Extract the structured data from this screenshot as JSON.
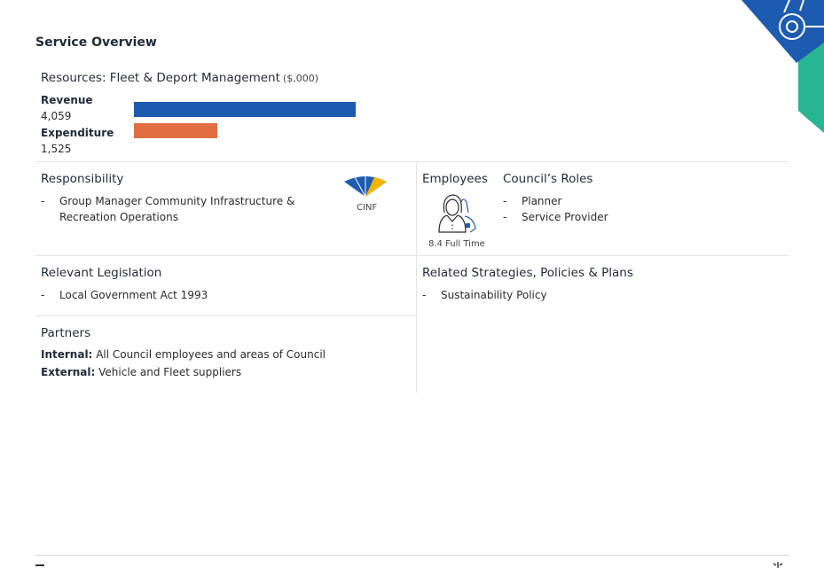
{
  "page_title": "Service Overview",
  "resources": {
    "title": "Resources: Fleet & Deport Management",
    "unit": "($,000)",
    "revenue_label": "Revenue",
    "revenue_value": "4,059",
    "expenditure_label": "Expenditure",
    "expenditure_value": "1,525"
  },
  "chart_data": {
    "type": "bar",
    "categories": [
      "Revenue",
      "Expenditure"
    ],
    "values": [
      4059,
      1525
    ],
    "colors": [
      "#1d5bb0",
      "#e16d40"
    ]
  },
  "responsibility": {
    "title": "Responsibility",
    "items": [
      "Group Manager Community Infrastructure & Recreation Operations"
    ],
    "directorate_label": "CINF"
  },
  "employees": {
    "title": "Employees",
    "count_label": "8.4 Full Time"
  },
  "roles": {
    "title": "Council’s Roles",
    "items": [
      "Planner",
      "Service Provider"
    ]
  },
  "legislation": {
    "title": "Relevant Legislation",
    "items": [
      "Local Government Act 1993"
    ]
  },
  "strategies": {
    "title": "Related Strategies, Policies & Plans",
    "items": [
      "Sustainability Policy"
    ]
  },
  "partners": {
    "title": "Partners",
    "internal_label": "Internal:",
    "internal_text": "All Council employees and areas of Council",
    "external_label": "External:",
    "external_text": "Vehicle and Fleet suppliers"
  },
  "icons": {
    "directorate": "directorate-fan-icon",
    "employee": "employee-person-icon",
    "corner": "tractor-icon"
  },
  "colors": {
    "blue": "#1d5bb0",
    "orange": "#e16d40",
    "teal": "#27b592",
    "yellow": "#f5b400"
  }
}
